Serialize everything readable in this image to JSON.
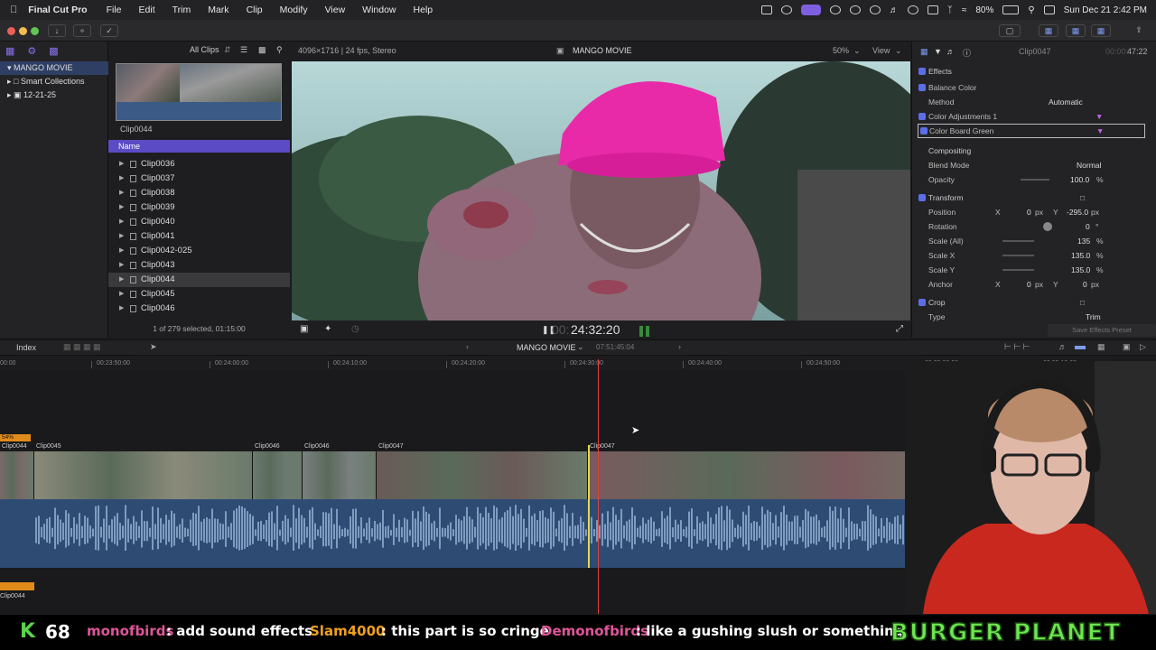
{
  "menubar": {
    "app": "Final Cut Pro",
    "items": [
      "File",
      "Edit",
      "Trim",
      "Mark",
      "Clip",
      "Modify",
      "View",
      "Window",
      "Help"
    ],
    "battery": "80%",
    "datetime": "Sun Dec 21  2:42 PM"
  },
  "browser": {
    "filter": "All Clips",
    "libraries": [
      {
        "label": "MANGO MOVIE",
        "selected": true
      },
      {
        "label": "Smart Collections",
        "selected": false
      },
      {
        "label": "12-21-25",
        "selected": false
      }
    ],
    "filmstrip_label": "Clip0044",
    "column_header": "Name",
    "clips": [
      "Clip0036",
      "Clip0037",
      "Clip0038",
      "Clip0039",
      "Clip0040",
      "Clip0041",
      "Clip0042-025",
      "Clip0043",
      "Clip0044",
      "Clip0045",
      "Clip0046"
    ],
    "selected_clip": "Clip0044",
    "footer": "1 of 279 selected, 01:15:00"
  },
  "viewer": {
    "format": "4096×1716 | 24 fps, Stereo",
    "project": "MANGO MOVIE",
    "zoom": "50%",
    "view_label": "View",
    "timecode_dim": "00:",
    "timecode": "24:32:20"
  },
  "inspector": {
    "clip_name": "Clip0047",
    "duration_dim": "00:00:",
    "duration": "47:22",
    "effects_label": "Effects",
    "balance_color": "Balance Color",
    "method_label": "Method",
    "method_value": "Automatic",
    "color_adjustments": "Color Adjustments 1",
    "color_board": "Color Board Green",
    "compositing": "Compositing",
    "blend_mode_label": "Blend Mode",
    "blend_mode_value": "Normal",
    "opacity_label": "Opacity",
    "opacity_value": "100.0",
    "transform": "Transform",
    "position_label": "Position",
    "position_x": "0",
    "position_y": "-295.0",
    "rotation_label": "Rotation",
    "rotation_value": "0",
    "scale_all_label": "Scale (All)",
    "scale_all_value": "135",
    "scale_x_label": "Scale X",
    "scale_x_value": "135.0",
    "scale_y_label": "Scale Y",
    "scale_y_value": "135.0",
    "anchor_label": "Anchor",
    "anchor_x": "0",
    "anchor_y": "0",
    "crop": "Crop",
    "type_label": "Type",
    "type_value": "Trim",
    "save_preset": "Save Effects Preset",
    "px": "px",
    "pct": "%",
    "deg": "°",
    "x": "X",
    "y": "Y"
  },
  "timeline": {
    "index_label": "Index",
    "project": "MANGO MOVIE",
    "duration": "07:51:45:04",
    "ruler": [
      "00:23:50:00",
      "00:24:00:00",
      "00:24:10:00",
      "00:24:20:00",
      "00:24:30:00",
      "00:24:40:00",
      "00:24:50:00",
      "00:25:00:00",
      "00:25:10:00"
    ],
    "ruler_left": "00:00",
    "clips": [
      "Clip0044",
      "Clip0045",
      "Clip0046",
      "Clip0046",
      "Clip0047",
      "Clip0047"
    ],
    "connected_clip": "Clip0044",
    "badge": "54%"
  },
  "chat": {
    "k_label": "K",
    "k_count": "68",
    "messages": [
      {
        "user": "monofbirds",
        "text": ": add sound effects",
        "color": "#e0559a"
      },
      {
        "user": "Slam4000",
        "text": ": this part is so cringe",
        "color": "#f0a020"
      },
      {
        "user": "Demonofbirds",
        "text": ": like a gushing slush or something",
        "color": "#e0559a"
      }
    ],
    "brand": "BURGER PLANET"
  }
}
